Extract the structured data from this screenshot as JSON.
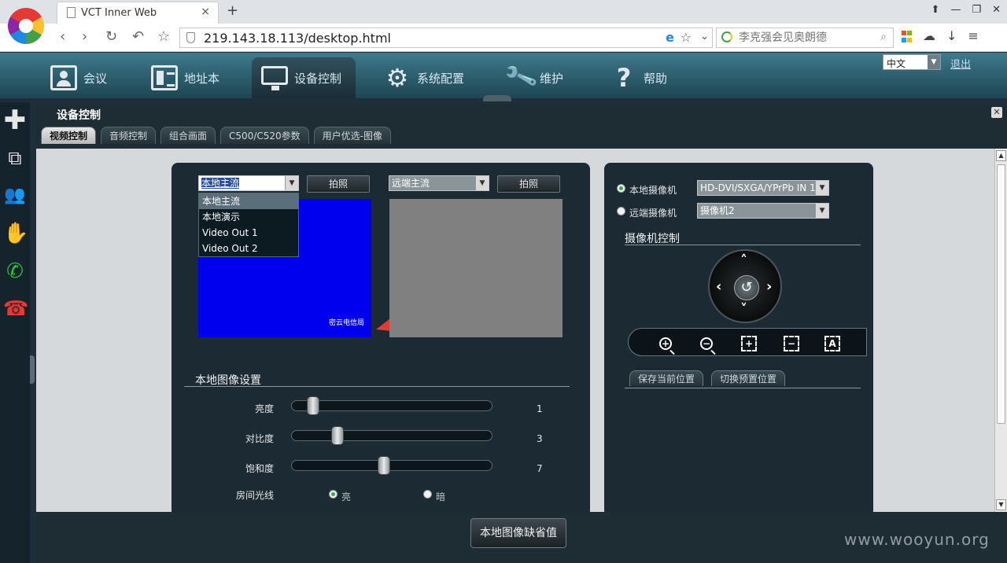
{
  "browser": {
    "tab_title": "VCT Inner Web",
    "tab_close": "×",
    "new_tab": "+",
    "url": "219.143.18.113/desktop.html",
    "search_placeholder": "李克强会见奥朗德",
    "window_controls": [
      "⬆",
      "—",
      "❐",
      "✕"
    ]
  },
  "header": {
    "nav": [
      {
        "label": "会议",
        "icon": "meeting-icon"
      },
      {
        "label": "地址本",
        "icon": "address-book-icon"
      },
      {
        "label": "设备控制",
        "icon": "monitor-icon",
        "active": true
      },
      {
        "label": "系统配置",
        "icon": "gear-icon"
      },
      {
        "label": "维护",
        "icon": "wrench-icon"
      },
      {
        "label": "帮助",
        "icon": "help-icon"
      }
    ],
    "language": "中文",
    "logout": "退出"
  },
  "sidebar": {
    "icons": [
      "add-icon",
      "contact-search-icon",
      "group-icon",
      "hand-raise-icon",
      "call-icon",
      "hangup-icon"
    ]
  },
  "panel": {
    "title": "设备控制",
    "close": "✕",
    "tabs": [
      {
        "label": "视频控制",
        "active": true
      },
      {
        "label": "音频控制"
      },
      {
        "label": "组合画面"
      },
      {
        "label": "C500/C520参数"
      },
      {
        "label": "用户优选-图像"
      }
    ]
  },
  "video": {
    "local_stream": "本地主流",
    "remote_stream": "远端主流",
    "snapshot": "拍照",
    "dropdown_options": [
      "本地主流",
      "本地演示",
      "Video Out 1",
      "Video Out 2"
    ],
    "local_overlay_text": "密云电信局",
    "local_color": "#0000ee",
    "remote_color": "#808080"
  },
  "image_settings": {
    "title": "本地图像设置",
    "sliders": [
      {
        "label": "亮度",
        "value": 1,
        "fraction": 0.08
      },
      {
        "label": "对比度",
        "value": 3,
        "fraction": 0.21
      },
      {
        "label": "饱和度",
        "value": 7,
        "fraction": 0.46
      }
    ],
    "room_light_label": "房间光线",
    "room_light_options": [
      {
        "label": "亮",
        "selected": true
      },
      {
        "label": "暗",
        "selected": false
      }
    ]
  },
  "camera": {
    "local_camera_label": "本地摄像机",
    "remote_camera_label": "远端摄像机",
    "local_source": "HD-DVI/SXGA/YPrPb IN 1",
    "remote_source": "摄像机2",
    "control_title": "摄像机控制",
    "save_position": "保存当前位置",
    "switch_preset": "切换预置位置",
    "zoom_buttons": [
      "zoom-in-icon",
      "zoom-out-icon",
      "focus-near-icon",
      "focus-far-icon",
      "auto-focus-icon"
    ]
  },
  "footer": {
    "default_button": "本地图像缺省值",
    "watermark": "www.wooyun.org"
  }
}
